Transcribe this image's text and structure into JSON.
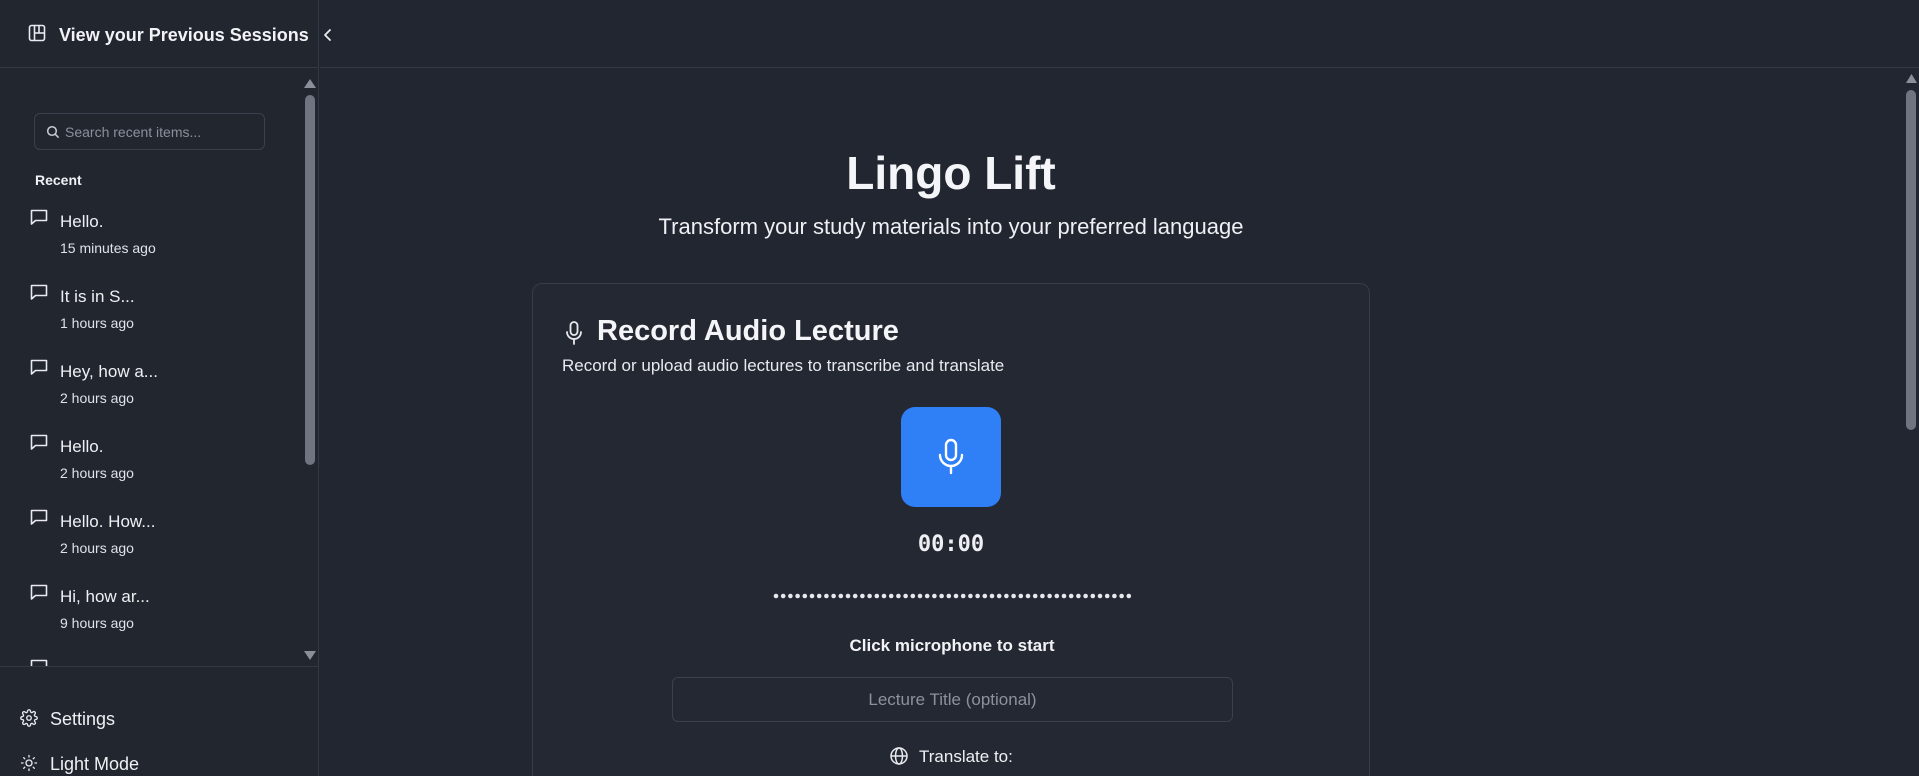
{
  "sidebar": {
    "header_title": "View your Previous Sessions",
    "search_placeholder": "Search recent items...",
    "recent_label": "Recent",
    "sessions": [
      {
        "title": "Hello.",
        "time": "15 minutes ago"
      },
      {
        "title": "It is in S...",
        "time": "1 hours ago"
      },
      {
        "title": "Hey, how a...",
        "time": "2 hours ago"
      },
      {
        "title": "Hello.",
        "time": "2 hours ago"
      },
      {
        "title": "Hello. How...",
        "time": "2 hours ago"
      },
      {
        "title": "Hi, how ar...",
        "time": "9 hours ago"
      }
    ],
    "footer": {
      "settings_label": "Settings",
      "theme_label": "Light Mode"
    }
  },
  "main": {
    "title": "Lingo Lift",
    "subtitle": "Transform your study materials into your preferred language",
    "card": {
      "title": "Record Audio Lecture",
      "description": "Record or upload audio lectures to transcribe and translate",
      "timer": "00:00",
      "hint": "Click microphone to start",
      "lecture_title_placeholder": "Lecture Title (optional)",
      "translate_label": "Translate to:"
    }
  },
  "colors": {
    "background": "#222630",
    "accent": "#2f7ff6",
    "border": "#323846"
  }
}
